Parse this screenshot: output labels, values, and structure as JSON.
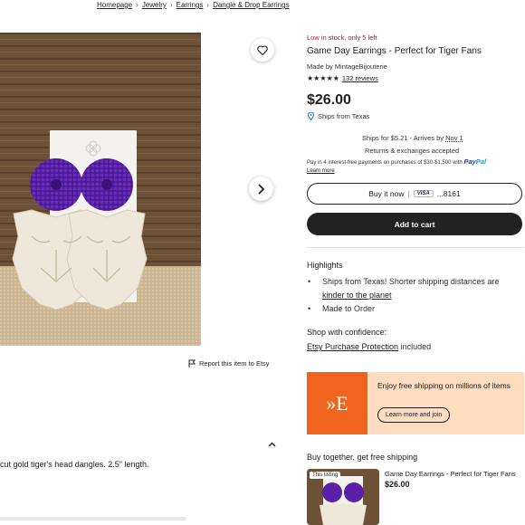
{
  "breadcrumb": [
    "Homepage",
    "Jewelry",
    "Earrings",
    "Dangle & Drop Earrings"
  ],
  "gallery": {
    "report_label": "Report this item to Etsy"
  },
  "description": {
    "text": "cut gold tiger's head dangles. 2.5\" length."
  },
  "product": {
    "stock_note": "Low in stock, only 5 left",
    "title": "Game Day Earrings - Perfect for Tiger Fans",
    "made_by": "Made by MintageBijouterie",
    "stars": "★★★★★",
    "reviews": "132 reviews",
    "price": "$26.00",
    "ships_from": "Ships from Texas"
  },
  "shipping": {
    "ships_for": "Ships for $5.21 - Arrives by",
    "arrives": "Nov 1",
    "returns": "Returns & exchanges accepted",
    "installments": "Pay in 4 interest-free payments on purchases of $30-$1,500 with",
    "paypal_a": "Pay",
    "paypal_b": "Pal",
    "learn_more": "Learn more"
  },
  "actions": {
    "buy_now": "Buy it now",
    "card_brand": "VISA",
    "card_last4": "...8161",
    "add_to_cart": "Add to cart"
  },
  "highlights": {
    "title": "Highlights",
    "items": [
      "Ships from Texas! Shorter shipping distances are",
      "kinder to the planet",
      "Made to Order"
    ]
  },
  "confidence": {
    "title": "Shop with confidence:",
    "link": "Etsy Purchase Protection",
    "suffix": " included"
  },
  "promo": {
    "logo": "»E",
    "text": "Enjoy free shipping on millions of items",
    "button": "Learn more and join"
  },
  "bundle": {
    "title": "Buy together, get free shipping",
    "badge": "This listing",
    "name": "Game Day Earrings - Perfect for Tiger Fans",
    "price": "$26.00"
  },
  "colors": {
    "stock_red": "#a61a2e",
    "etsy_orange": "#f1641e",
    "promo_bg": "#fddcc0",
    "bead_purple": "#5a21a8"
  }
}
